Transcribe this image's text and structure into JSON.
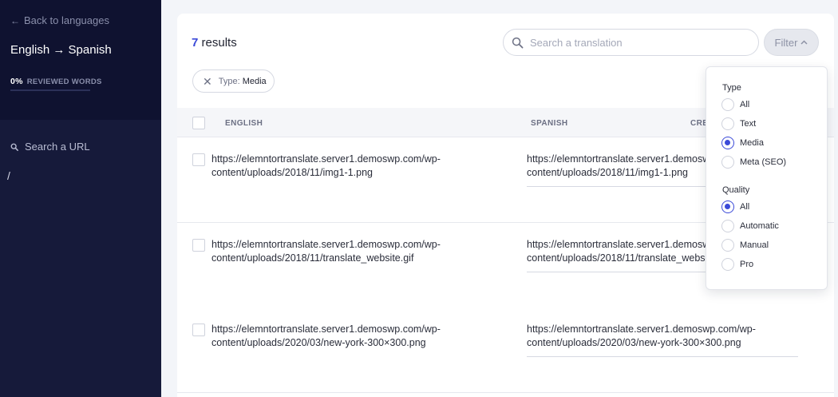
{
  "sidebar": {
    "back_label": "Back to languages",
    "language_pair": "English → Spanish",
    "reviewed_percent": "0%",
    "reviewed_label": "REVIEWED WORDS",
    "reviewed_fraction": 0.0,
    "url_search_label": "Search a URL",
    "url_root": "/"
  },
  "header": {
    "results_count": "7",
    "results_label": "results",
    "search_placeholder": "Search a translation",
    "filter_label": "Filter"
  },
  "active_filter": {
    "label": "Type:",
    "value": "Media"
  },
  "table": {
    "columns": [
      "ENGLISH",
      "SPANISH",
      "CRE"
    ],
    "rows": [
      {
        "english": "https://elemntortranslate.server1.demoswp.com/wp-content/uploads/2018/11/img1-1.png",
        "spanish": "https://elemntortranslate.server1.demoswp.com/wp-content/uploads/2018/11/img1-1.png"
      },
      {
        "english": "https://elemntortranslate.server1.demoswp.com/wp-content/uploads/2018/11/translate_website.gif",
        "spanish": "https://elemntortranslate.server1.demoswp.com/wp-content/uploads/2018/11/translate_website.gif"
      },
      {
        "english": "https://elemntortranslate.server1.demoswp.com/wp-content/uploads/2020/03/new-york-300×300.png",
        "spanish": "https://elemntortranslate.server1.demoswp.com/wp-content/uploads/2020/03/new-york-300×300.png"
      }
    ]
  },
  "filter_menu": {
    "type_heading": "Type",
    "type_options": [
      "All",
      "Text",
      "Media",
      "Meta (SEO)"
    ],
    "type_selected": "Media",
    "quality_heading": "Quality",
    "quality_options": [
      "All",
      "Automatic",
      "Manual",
      "Pro"
    ],
    "quality_selected": "All"
  },
  "icons": {
    "back": "arrow-left-icon",
    "url_search": "search-icon",
    "translation_search": "search-icon",
    "filter_caret": "chevron-up-icon",
    "chip_remove": "close-icon"
  },
  "colors": {
    "sidebar_bg": "#161a3a",
    "sidebar_top_bg": "#0f1230",
    "accent": "#3b4ad8",
    "page_bg": "#f3f5f9"
  }
}
